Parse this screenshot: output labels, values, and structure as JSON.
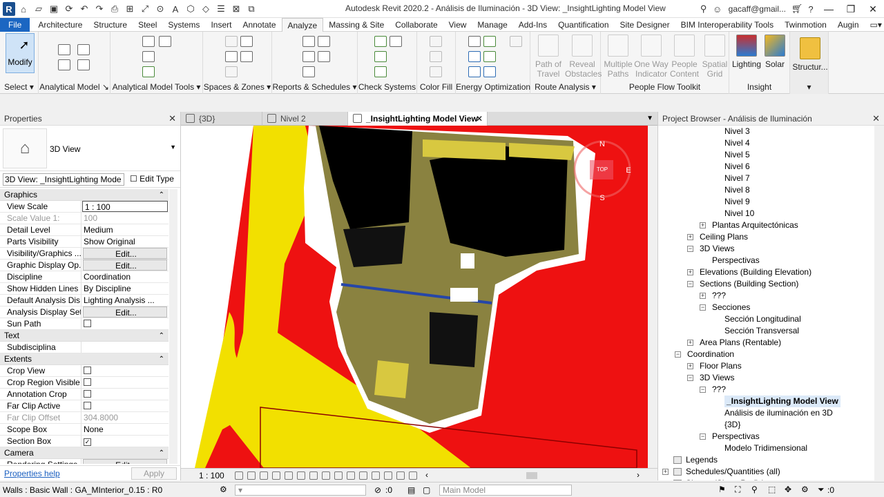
{
  "window": {
    "title": "Autodesk Revit 2020.2 - Análisis de Iluminación - 3D View: _InsightLighting Model View",
    "user": "gacaff@gmail...",
    "help": "?"
  },
  "menu_tabs": [
    "File",
    "Architecture",
    "Structure",
    "Steel",
    "Systems",
    "Insert",
    "Annotate",
    "Analyze",
    "Massing & Site",
    "Collaborate",
    "View",
    "Manage",
    "Add-Ins",
    "Quantification",
    "Site Designer",
    "BIM Interoperability Tools",
    "Twinmotion",
    "Augin"
  ],
  "active_tab": "Analyze",
  "ribbon": {
    "modify": "Modify",
    "panels": [
      "Select",
      "Analytical Model",
      "Analytical Model Tools",
      "Spaces & Zones",
      "Reports & Schedules",
      "Check Systems",
      "Color Fill",
      "Energy Optimization",
      "Route Analysis",
      "People Flow Toolkit",
      "Insight"
    ],
    "people_flow_buttons": [
      "Path of Travel",
      "Reveal Obstacles",
      "Multiple Paths",
      "One Way Indicator",
      "People Content",
      "Spatial Grid"
    ],
    "insight_buttons": [
      "Lighting",
      "Solar"
    ],
    "structur": "Structur..."
  },
  "properties": {
    "title": "Properties",
    "type_name": "3D View",
    "instance": "3D View: _InsightLighting Mode",
    "edit_type": "Edit Type",
    "sections": [
      {
        "name": "Graphics",
        "rows": [
          {
            "k": "View Scale",
            "v": "1 : 100",
            "kind": "box"
          },
          {
            "k": "Scale Value    1:",
            "v": "100",
            "kind": "grey"
          },
          {
            "k": "Detail Level",
            "v": "Medium"
          },
          {
            "k": "Parts Visibility",
            "v": "Show Original"
          },
          {
            "k": "Visibility/Graphics ...",
            "v": "Edit...",
            "kind": "btn"
          },
          {
            "k": "Graphic Display Op...",
            "v": "Edit...",
            "kind": "btn"
          },
          {
            "k": "Discipline",
            "v": "Coordination"
          },
          {
            "k": "Show Hidden Lines",
            "v": "By Discipline"
          },
          {
            "k": "Default Analysis Dis...",
            "v": "Lighting Analysis ..."
          },
          {
            "k": "Analysis Display Set...",
            "v": "Edit...",
            "kind": "btn"
          },
          {
            "k": "Sun Path",
            "v": "",
            "kind": "check"
          }
        ]
      },
      {
        "name": "Text",
        "rows": [
          {
            "k": "Subdisciplina",
            "v": ""
          }
        ]
      },
      {
        "name": "Extents",
        "rows": [
          {
            "k": "Crop View",
            "v": "",
            "kind": "check"
          },
          {
            "k": "Crop Region Visible",
            "v": "",
            "kind": "check"
          },
          {
            "k": "Annotation Crop",
            "v": "",
            "kind": "check"
          },
          {
            "k": "Far Clip Active",
            "v": "",
            "kind": "check"
          },
          {
            "k": "Far Clip Offset",
            "v": "304.8000",
            "kind": "grey"
          },
          {
            "k": "Scope Box",
            "v": "None"
          },
          {
            "k": "Section Box",
            "v": "✓",
            "kind": "checked"
          }
        ]
      },
      {
        "name": "Camera",
        "rows": [
          {
            "k": "Rendering Settings",
            "v": "Edit...",
            "kind": "btn"
          }
        ]
      }
    ],
    "help_link": "Properties help",
    "apply": "Apply"
  },
  "view_tabs": [
    "{3D}",
    "Nivel 2",
    "_InsightLighting Model View"
  ],
  "viewcube": {
    "n": "N",
    "s": "S",
    "e": "E",
    "top": "TOP"
  },
  "view_scale": "1 : 100",
  "browser": {
    "title": "Project Browser - Análisis de Iluminación",
    "nodes": [
      {
        "t": "Nivel 3",
        "d": 4
      },
      {
        "t": "Nivel 4",
        "d": 4
      },
      {
        "t": "Nivel 5",
        "d": 4
      },
      {
        "t": "Nivel 6",
        "d": 4
      },
      {
        "t": "Nivel 7",
        "d": 4
      },
      {
        "t": "Nivel 8",
        "d": 4
      },
      {
        "t": "Nivel 9",
        "d": 4
      },
      {
        "t": "Nivel 10",
        "d": 4
      },
      {
        "t": "Plantas Arquitectónicas",
        "d": 3,
        "g": "+"
      },
      {
        "t": "Ceiling Plans",
        "d": 2,
        "g": "+"
      },
      {
        "t": "3D Views",
        "d": 2,
        "g": "−"
      },
      {
        "t": "Perspectivas",
        "d": 3
      },
      {
        "t": "Elevations (Building Elevation)",
        "d": 2,
        "g": "+"
      },
      {
        "t": "Sections (Building Section)",
        "d": 2,
        "g": "−"
      },
      {
        "t": "???",
        "d": 3,
        "g": "+"
      },
      {
        "t": "Secciones",
        "d": 3,
        "g": "−"
      },
      {
        "t": "Sección Longitudinal",
        "d": 4
      },
      {
        "t": "Sección Transversal",
        "d": 4
      },
      {
        "t": "Area Plans (Rentable)",
        "d": 2,
        "g": "+"
      },
      {
        "t": "Coordination",
        "d": 1,
        "g": "−"
      },
      {
        "t": "Floor Plans",
        "d": 2,
        "g": "+"
      },
      {
        "t": "3D Views",
        "d": 2,
        "g": "−"
      },
      {
        "t": "???",
        "d": 3,
        "g": "−"
      },
      {
        "t": "_InsightLighting Model View",
        "d": 4,
        "sel": true
      },
      {
        "t": "Análisis de iluminación en 3D",
        "d": 4
      },
      {
        "t": "{3D}",
        "d": 4
      },
      {
        "t": "Perspectivas",
        "d": 3,
        "g": "−"
      },
      {
        "t": "Modelo Tridimensional",
        "d": 4
      },
      {
        "t": "Legends",
        "d": 0
      },
      {
        "t": "Schedules/Quantities (all)",
        "d": 0,
        "g": "+"
      },
      {
        "t": "Sheets (Sheet Prefix)",
        "d": 0,
        "g": "+"
      }
    ]
  },
  "status": {
    "text": "Walls : Basic Wall : GA_MInterior_0.15 : R0",
    "zero": ":0",
    "model": "Main Model",
    "right_zero": ":0"
  },
  "colors": {
    "accent": "#1b66c2",
    "red": "#ee1111",
    "yellow": "#f2e000",
    "olive": "#8a8240"
  }
}
